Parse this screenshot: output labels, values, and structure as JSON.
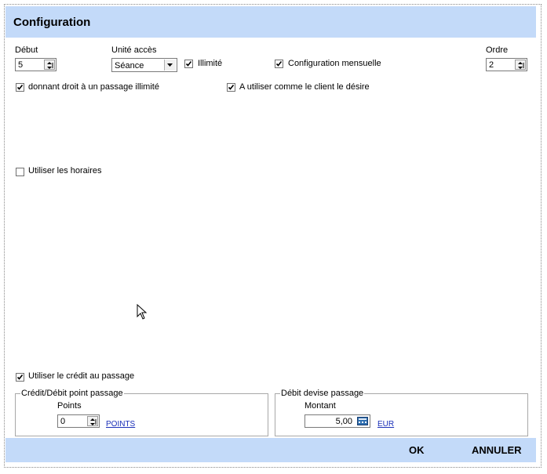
{
  "dialog": {
    "title": "Configuration"
  },
  "fields": {
    "debut": {
      "label": "Début",
      "value": "5"
    },
    "unite_acces": {
      "label": "Unité accès",
      "value": "Séance"
    },
    "ordre": {
      "label": "Ordre",
      "value": "2"
    }
  },
  "checkboxes": {
    "illimite": {
      "label": "Illimité",
      "checked": true
    },
    "config_mensuelle": {
      "label": "Configuration mensuelle",
      "checked": true
    },
    "droit_illimite": {
      "label": "donnant droit à un passage illimité",
      "checked": true
    },
    "utiliser_client": {
      "label": "A utiliser comme le client le désire",
      "checked": true
    },
    "utiliser_horaires": {
      "label": "Utiliser les horaires",
      "checked": false
    },
    "utiliser_credit": {
      "label": "Utiliser le crédit au passage",
      "checked": true
    }
  },
  "groups": {
    "credit_debit": {
      "title": "Crédit/Débit point passage",
      "points_label": "Points",
      "points_value": "0",
      "unit_link": "POINTS"
    },
    "debit_devise": {
      "title": "Débit devise passage",
      "montant_label": "Montant",
      "montant_value": "5,00",
      "currency_link": "EUR"
    }
  },
  "footer": {
    "ok_label": "OK",
    "cancel_label": "ANNULER"
  },
  "colors": {
    "header": "#c3daf9",
    "link": "#1a2fb8"
  },
  "icons": [
    "spinner-icon",
    "dropdown-arrow-icon",
    "checkmark-icon",
    "calculator-icon",
    "mouse-cursor-icon"
  ]
}
